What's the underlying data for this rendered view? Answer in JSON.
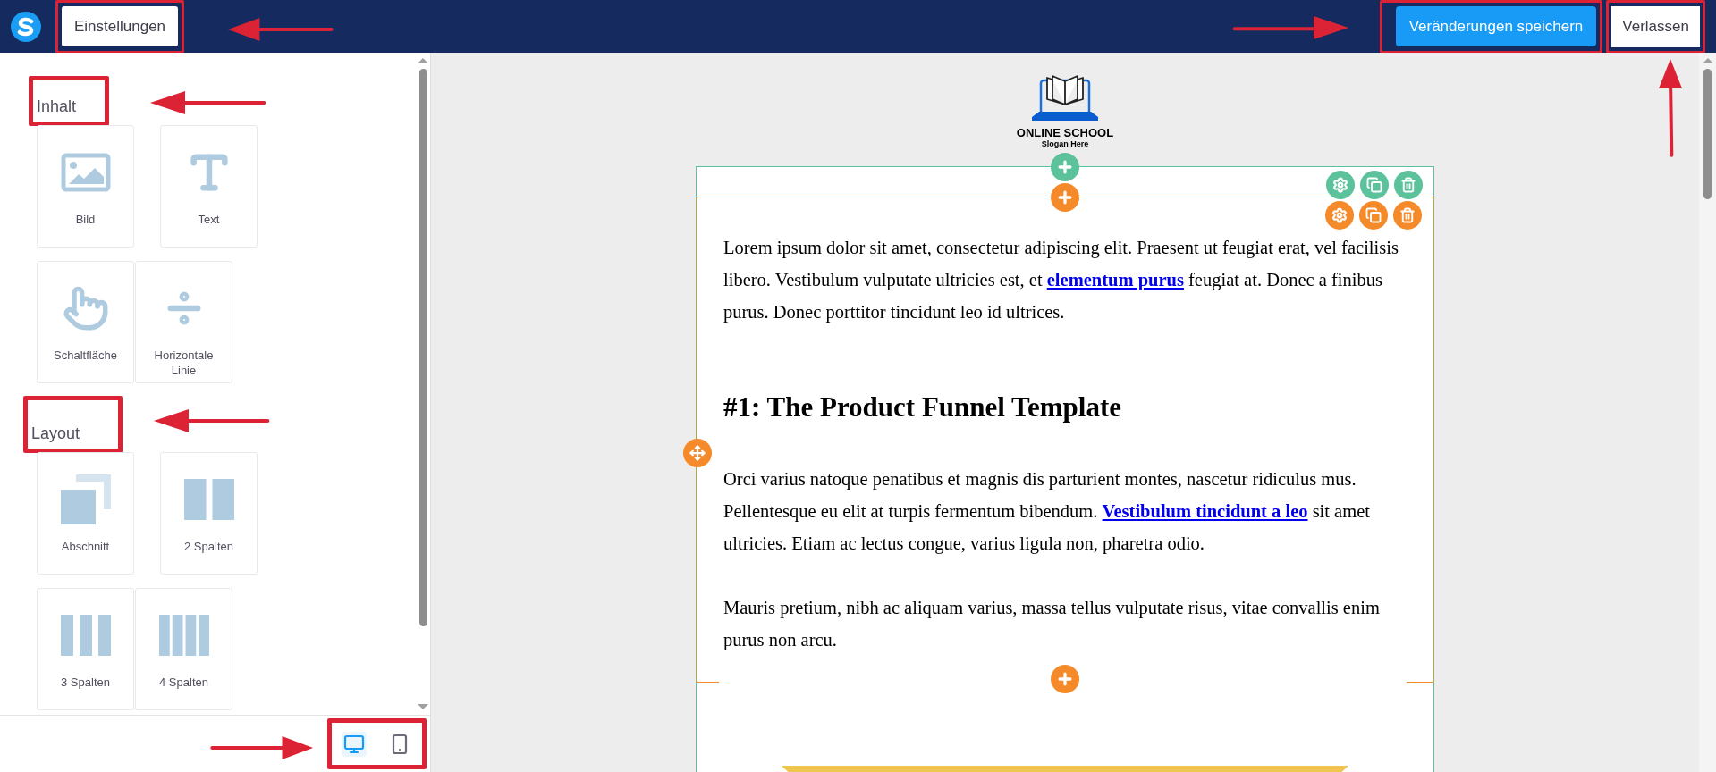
{
  "topbar": {
    "settings_button": "Einstellungen",
    "save_button": "Veränderungen speichern",
    "exit_button": "Verlassen"
  },
  "sidebar": {
    "sections": [
      {
        "title": "Inhalt",
        "rows": [
          [
            {
              "label": "Bild",
              "kind": "image"
            },
            {
              "label": "Text",
              "kind": "text"
            }
          ],
          [
            {
              "label": "Schaltfläche",
              "kind": "button"
            },
            {
              "label": "Horizontale Linie",
              "kind": "divider"
            }
          ]
        ]
      },
      {
        "title": "Layout",
        "rows": [
          [
            {
              "label": "Abschnitt",
              "kind": "section"
            },
            {
              "label": "2 Spalten",
              "kind": "columns2"
            }
          ],
          [
            {
              "label": "3 Spalten",
              "kind": "columns3"
            },
            {
              "label": "4 Spalten",
              "kind": "columns4"
            }
          ]
        ]
      }
    ],
    "devices": [
      {
        "kind": "desktop",
        "selected": true
      },
      {
        "kind": "mobile",
        "selected": false
      }
    ]
  },
  "canvas": {
    "logo": {
      "title": "ONLINE SCHOOL",
      "slogan": "Slogan Here"
    },
    "blocks": [
      {
        "kind": "paragraph",
        "parts": [
          {
            "text": "Lorem ipsum dolor sit amet, consectetur adipiscing elit. Praesent ut feugiat erat, vel facilisis libero. Vestibulum vulputate ultricies est, et "
          },
          {
            "text": "elementum purus",
            "kind": "link"
          },
          {
            "text": " feugiat at. Donec a finibus purus. Donec porttitor tincidunt leo id ultrices."
          }
        ]
      },
      {
        "kind": "heading",
        "text": "#1: The Product Funnel Template"
      },
      {
        "kind": "paragraph",
        "parts": [
          {
            "text": "Orci varius natoque penatibus et magnis dis parturient montes, nascetur ridiculus mus. Pellentesque eu elit at turpis fermentum bibendum. "
          },
          {
            "text": "Vestibulum tincidunt a leo",
            "kind": "link"
          },
          {
            "text": " sit amet ultricies. Etiam ac lectus congue, varius ligula non, pharetra odio."
          }
        ]
      },
      {
        "kind": "paragraph",
        "parts": [
          {
            "text": "Mauris pretium, nibh ac aliquam varius, massa tellus vulputate risus, vitae convallis enim purus non arcu."
          }
        ]
      }
    ]
  }
}
